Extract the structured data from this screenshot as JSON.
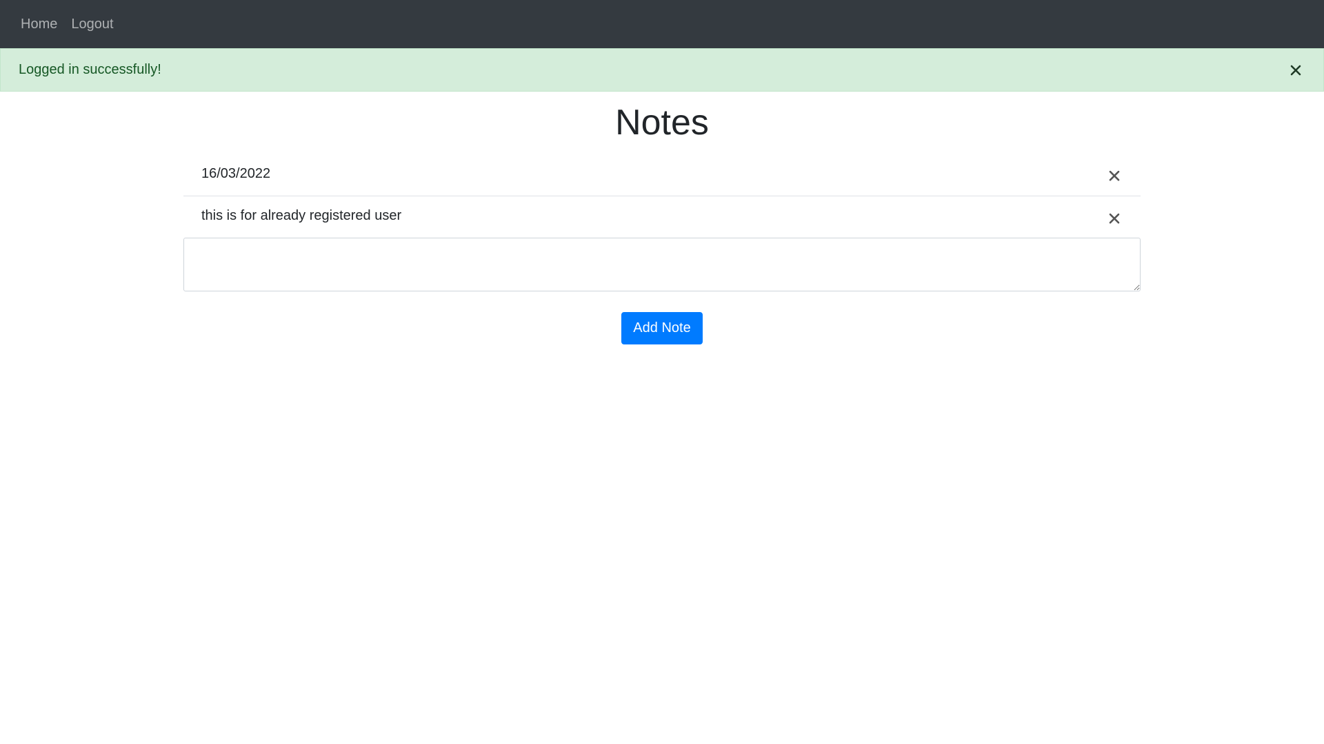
{
  "navbar": {
    "links": [
      {
        "label": "Home"
      },
      {
        "label": "Logout"
      }
    ],
    "background": "#343a40"
  },
  "alert": {
    "message": "Logged in successfully!",
    "close_icon": "close-icon",
    "background": "#d4edda",
    "text_color": "#155724"
  },
  "main": {
    "title": "Notes",
    "notes": [
      {
        "text": "16/03/2022",
        "delete_icon": "close-icon"
      },
      {
        "text": "this is for already registered user",
        "delete_icon": "close-icon"
      }
    ],
    "note_input": {
      "value": "",
      "placeholder": ""
    },
    "add_button_label": "Add Note",
    "accent_color": "#007bff"
  }
}
